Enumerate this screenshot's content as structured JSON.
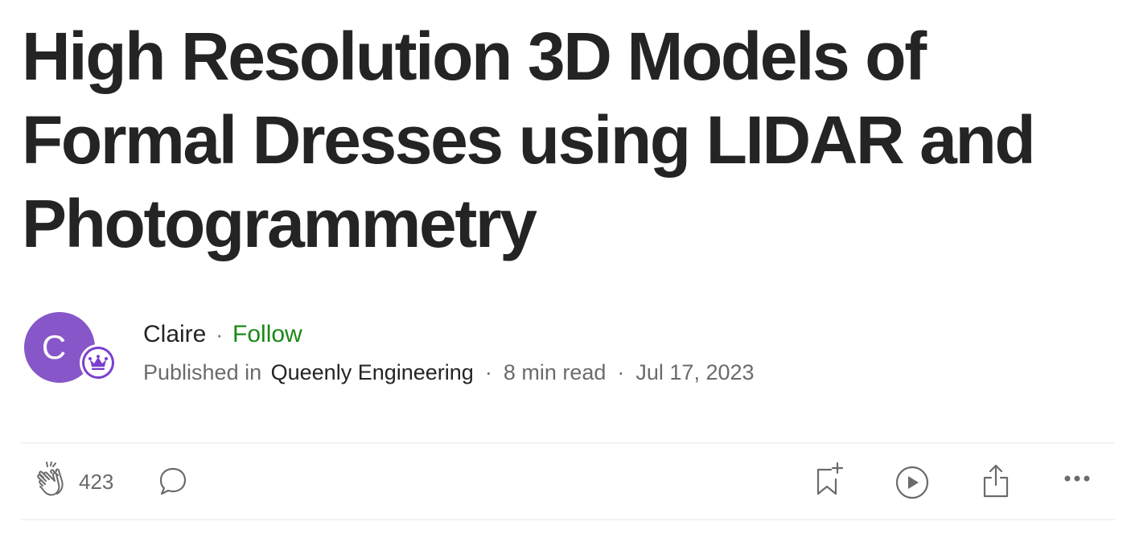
{
  "article": {
    "title": "High Resolution 3D Models of Formal Dresses using LIDAR and Photogrammetry"
  },
  "author": {
    "avatar_initial": "C",
    "name": "Claire",
    "separator": "·",
    "follow_label": "Follow",
    "published_in_label": "Published in",
    "publication": "Queenly Engineering",
    "read_time": "8 min read",
    "date": "Jul 17, 2023",
    "badge_icon": "crown-icon"
  },
  "actions": {
    "clap_icon": "clap-icon",
    "clap_count": "423",
    "comment_icon": "comment-icon",
    "bookmark_icon": "bookmark-add-icon",
    "listen_icon": "play-circle-icon",
    "share_icon": "share-icon",
    "more_icon": "more-horizontal-icon"
  },
  "colors": {
    "title": "#242424",
    "muted": "#6b6b6b",
    "follow": "#1a8917",
    "avatar": "#8756c8",
    "badge": "#7a3fd0",
    "divider": "#f2f2f2"
  }
}
